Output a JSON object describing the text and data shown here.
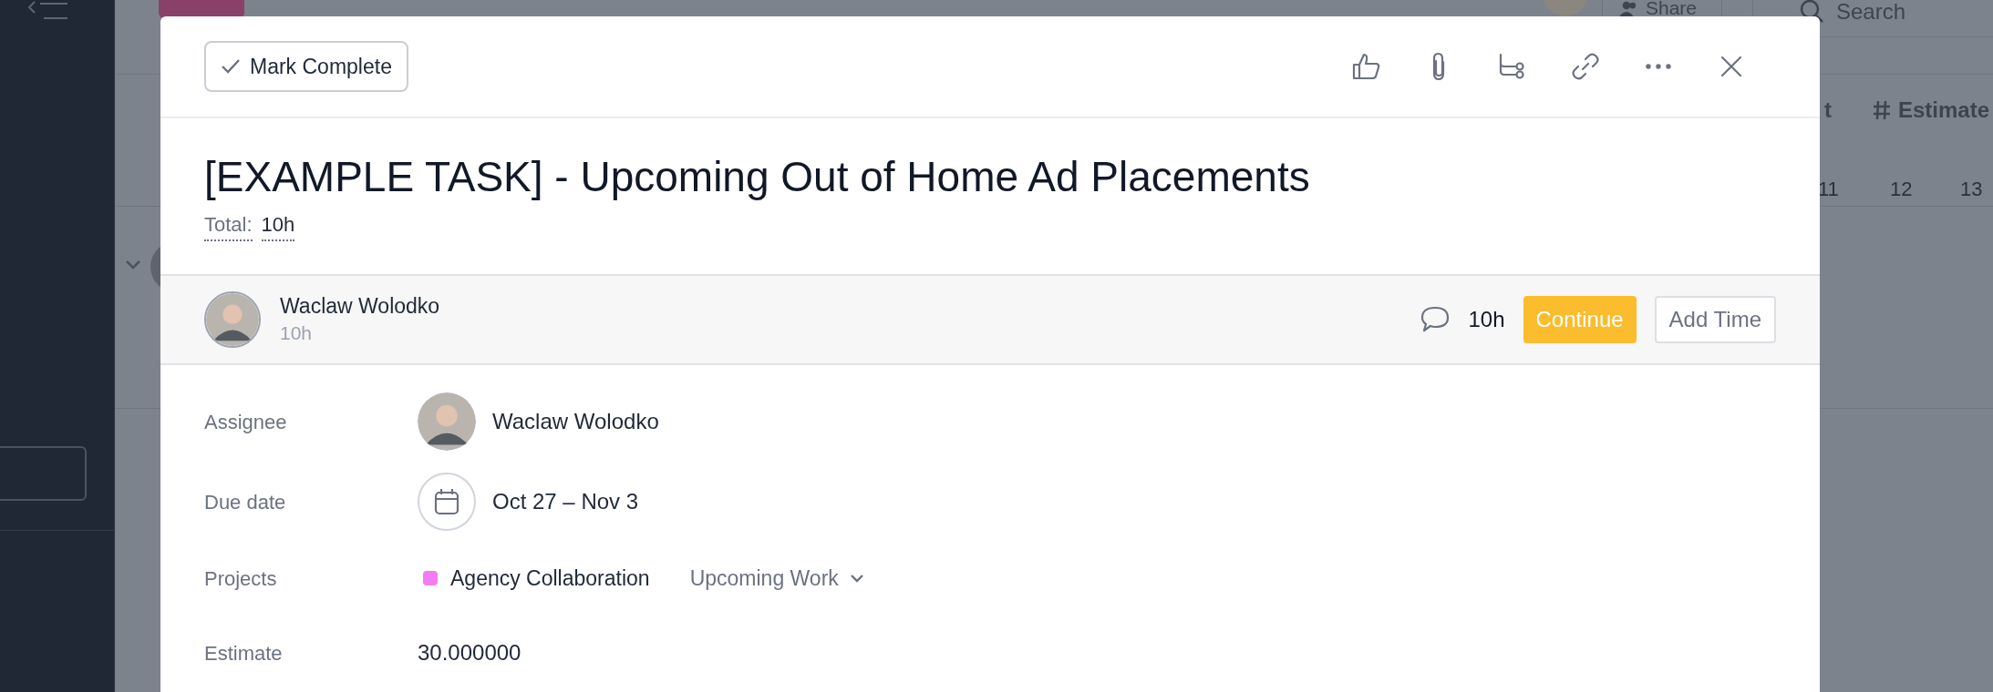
{
  "background": {
    "share_button": "Share",
    "search_placeholder": "Search",
    "column_fragment": "t",
    "estimate_column": "Estimate",
    "day_numbers": [
      "11",
      "12",
      "13"
    ]
  },
  "task": {
    "mark_complete": "Mark Complete",
    "title": "[EXAMPLE TASK] - Upcoming Out of Home Ad Placements",
    "total_label": "Total:",
    "total_value": "10h",
    "time_entry": {
      "user": "Waclaw Wolodko",
      "duration": "10h",
      "comment_total": "10h",
      "continue_button": "Continue",
      "add_time_button": "Add Time"
    },
    "fields": [
      {
        "kind": "person",
        "label": "Assignee",
        "value": "Waclaw Wolodko"
      },
      {
        "kind": "date",
        "label": "Due date",
        "value": "Oct 27 – Nov 3"
      },
      {
        "kind": "project",
        "label": "Projects",
        "value": "Agency Collaboration",
        "color": "#f47cf2",
        "section": "Upcoming Work"
      },
      {
        "kind": "text",
        "label": "Estimate",
        "value": "30.000000"
      }
    ]
  }
}
